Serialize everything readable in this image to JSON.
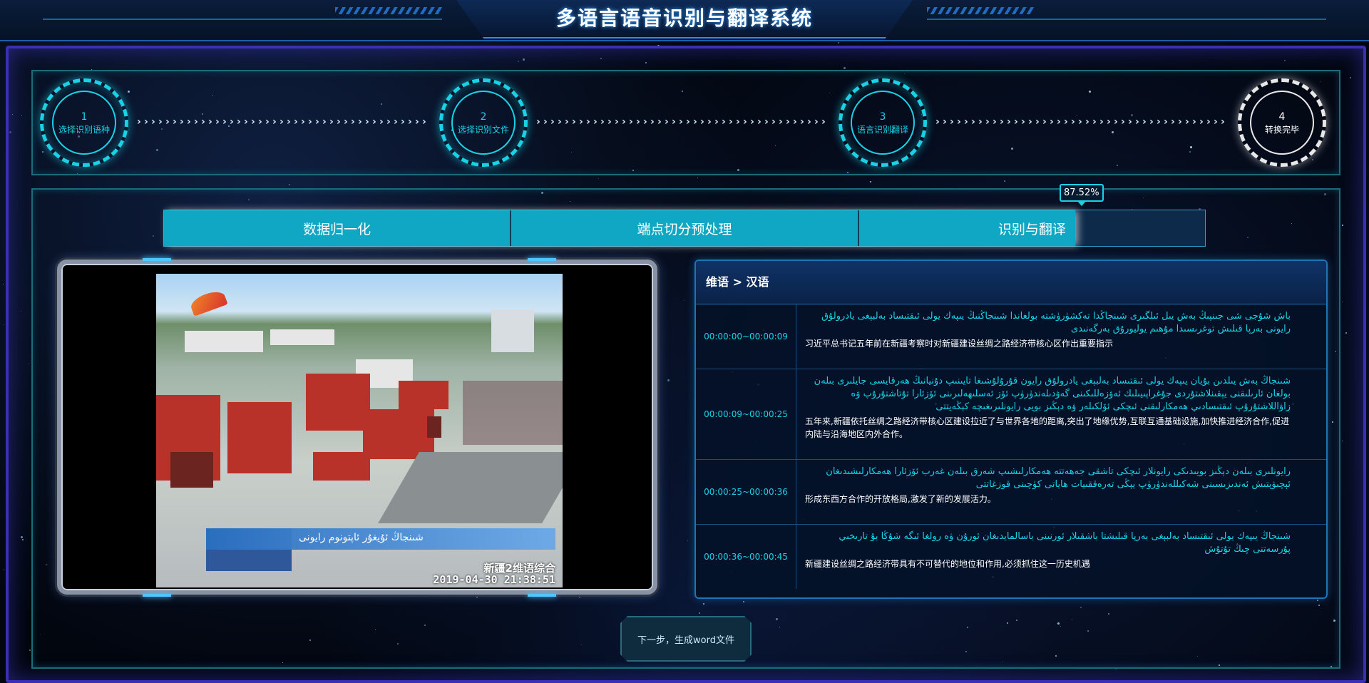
{
  "header": {
    "title": "多语言语音识别与翻译系统"
  },
  "steps": [
    {
      "num": "1",
      "label": "选择识别语种",
      "status": "active"
    },
    {
      "num": "2",
      "label": "选择识别文件",
      "status": "active"
    },
    {
      "num": "3",
      "label": "语言识别翻译",
      "status": "active"
    },
    {
      "num": "4",
      "label": "转换完毕",
      "status": "done"
    }
  ],
  "progress": {
    "percent_label": "87.52%",
    "fraction": 0.8752,
    "tabs": [
      "数据归一化",
      "端点切分预处理",
      "识别与翻译"
    ]
  },
  "video": {
    "caption": "شىنجاڭ ئۇيغۇر ئاپتونوم رايونى",
    "channel": "新疆2维语综合",
    "timestamp": "2019-04-30 21:38:51"
  },
  "translation": {
    "header": "维语 > 汉语",
    "rows": [
      {
        "time": "00:00:00~00:00:09",
        "uyghur": "باش شۇجى شى جىنپىڭ بەش يىل ئىلگىرى شىنجاڭدا تەكشۈرۈشتە بولغاندا شىنجاڭنىڭ يىپەك يولى ئىقتىساد بەلبېغى يادرولۇق رايونى بەرپا قىلىش توغرىسىدا مۇھىم يوليورۇق بەرگەنىدى",
        "chinese": "习近平总书记五年前在新疆考察时对新疆建设丝绸之路经济带核心区作出重要指示"
      },
      {
        "time": "00:00:09~00:00:25",
        "uyghur": "شىنجاڭ بەش يىلدىن بۇيان يىپەك يولى ئىقتىساد بەلبېغى يادرولۇق رايون قۇرۇلۇشىغا تايىنىپ دۇنيانىڭ ھەرقايسى جايلىرى بىلەن بولغان ئارىلىقنى يېقىنلاشتۇردى جۇغراپىيىلىك ئەۋزەللىكىنى گەۋدىلەندۈرۈپ ئۆز ئەسلىھەلىرىنى ئۆزئارا تۇتاشتۇرۇپ ۋە زاۋاللاشتۇرۇپ ئىقتىسادىي ھەمكارلىقنى ئىچكى ئۆلكىلەر ۋە دېڭىز بويى رايونلىرىغىچە كېڭەيتتى",
        "chinese": "五年来,新疆依托丝绸之路经济带核心区建设拉近了与世界各地的距离,突出了地缘优势,互联互通基础设施,加快推进经济合作,促进内陆与沿海地区内外合作。"
      },
      {
        "time": "00:00:25~00:00:36",
        "uyghur": "رايونلىرى بىلەن دېڭىز بويىدىكى رايونلار ئىچكى تاشقى جەھەتتە ھەمكارلىشىپ شەرق بىلەن غەرب ئۆزئارا ھەمكارلىشىدىغان ئېچىۋېتىش ئەندىزىسىنى شەكىللەندۈرۈپ يېڭى تەرەققىيات ھاياتى كۈچىنى قوزغاتتى",
        "chinese": "形成东西方合作的开放格局,激发了新的发展活力。"
      },
      {
        "time": "00:00:36~00:00:45",
        "uyghur": "شىنجاڭ يىپەك يولى ئىقتىساد بەلبېغى بەرپا قىلىشتا باشقىلار ئورنىنى باسالمايدىغان ئورۇن ۋە رولغا ئىگە شۇڭا بۇ تارىخىي پۇرسەتنى چىڭ تۇتۇش",
        "chinese": "新疆建设丝绸之路经济带具有不可替代的地位和作用,必须抓住这一历史机遇"
      }
    ]
  },
  "next_button": {
    "label": "下一步，生成word文件"
  },
  "colors": {
    "accent": "#19d2e6",
    "tab_fill": "#0fa7c3",
    "frame": "#3b2fb3"
  }
}
